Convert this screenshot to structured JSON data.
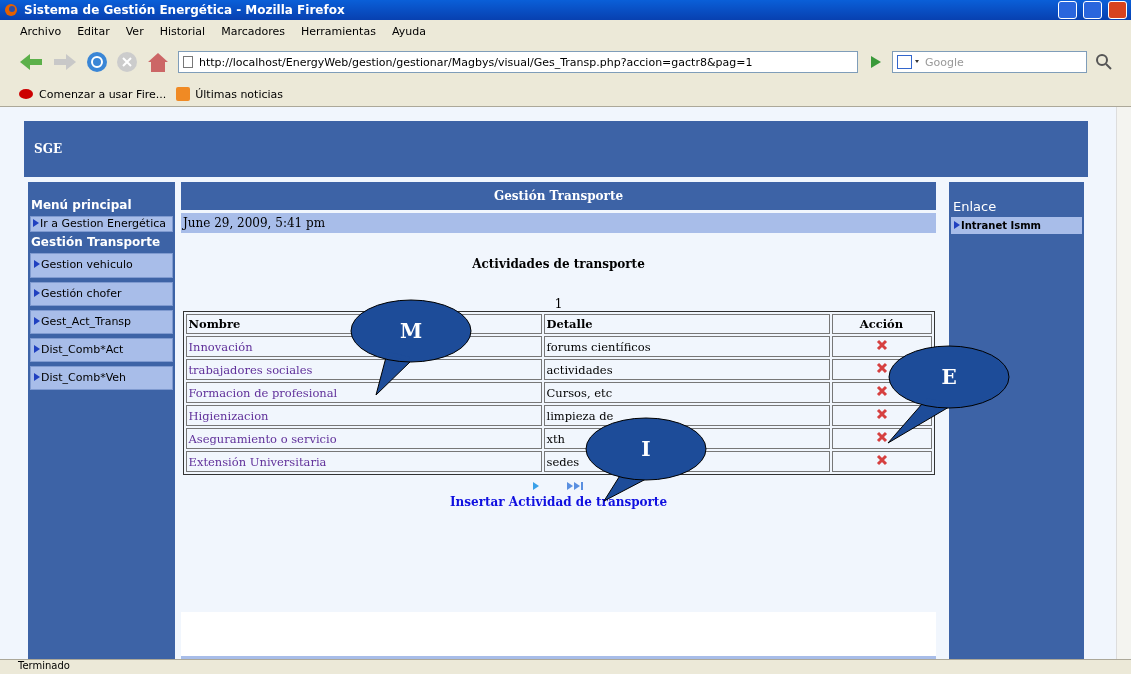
{
  "window": {
    "title": "Sistema de Gestión Energética - Mozilla Firefox"
  },
  "menu": [
    "Archivo",
    "Editar",
    "Ver",
    "Historial",
    "Marcadores",
    "Herramientas",
    "Ayuda"
  ],
  "toolbar": {
    "url": "http://localhost/EnergyWeb/gestion/gestionar/Magbys/visual/Ges_Transp.php?accion=gactr8&pag=1",
    "search_placeholder": "Google"
  },
  "bookmarks": [
    "Comenzar a usar Fire...",
    "Últimas noticias"
  ],
  "page": {
    "header": "SGE",
    "left_menu": [
      {
        "kind": "heading",
        "label": "Menú principal"
      },
      {
        "kind": "link",
        "label": "Ir a Gestion Energética"
      },
      {
        "kind": "heading",
        "label": "Gestión Transporte"
      },
      {
        "kind": "link",
        "label": "Gestion vehiculo"
      },
      {
        "kind": "link",
        "label": "Gestión chofer"
      },
      {
        "kind": "link",
        "label": "Gest_Act_Transp"
      },
      {
        "kind": "link",
        "label": "Dist_Comb*Act"
      },
      {
        "kind": "link",
        "label": "Dist_Comb*Veh"
      }
    ],
    "right_menu": {
      "title": "Enlace",
      "items": [
        "Intranet Ismm"
      ]
    },
    "main": {
      "title": "Gestión Transporte",
      "date": "June 29, 2009, 5:41 pm",
      "heading": "Actividades de transporte",
      "page_number": "1",
      "columns": [
        "Nombre",
        "Detalle",
        "Acción"
      ],
      "rows": [
        {
          "name": "Innovación",
          "detail": "forums científicos"
        },
        {
          "name": "trabajadores sociales",
          "detail": "actividades"
        },
        {
          "name": "Formacion de profesional",
          "detail": "Cursos, etc"
        },
        {
          "name": "Higienizacion",
          "detail": "limpieza de"
        },
        {
          "name": "Aseguramiento o servicio",
          "detail": "xth"
        },
        {
          "name": "Extensión Universitaria",
          "detail": "sedes"
        }
      ],
      "insert_link": "Insertar Actividad de transporte"
    }
  },
  "callouts": [
    {
      "label": "M"
    },
    {
      "label": "I"
    },
    {
      "label": "E"
    }
  ],
  "status_bar": "Terminado"
}
